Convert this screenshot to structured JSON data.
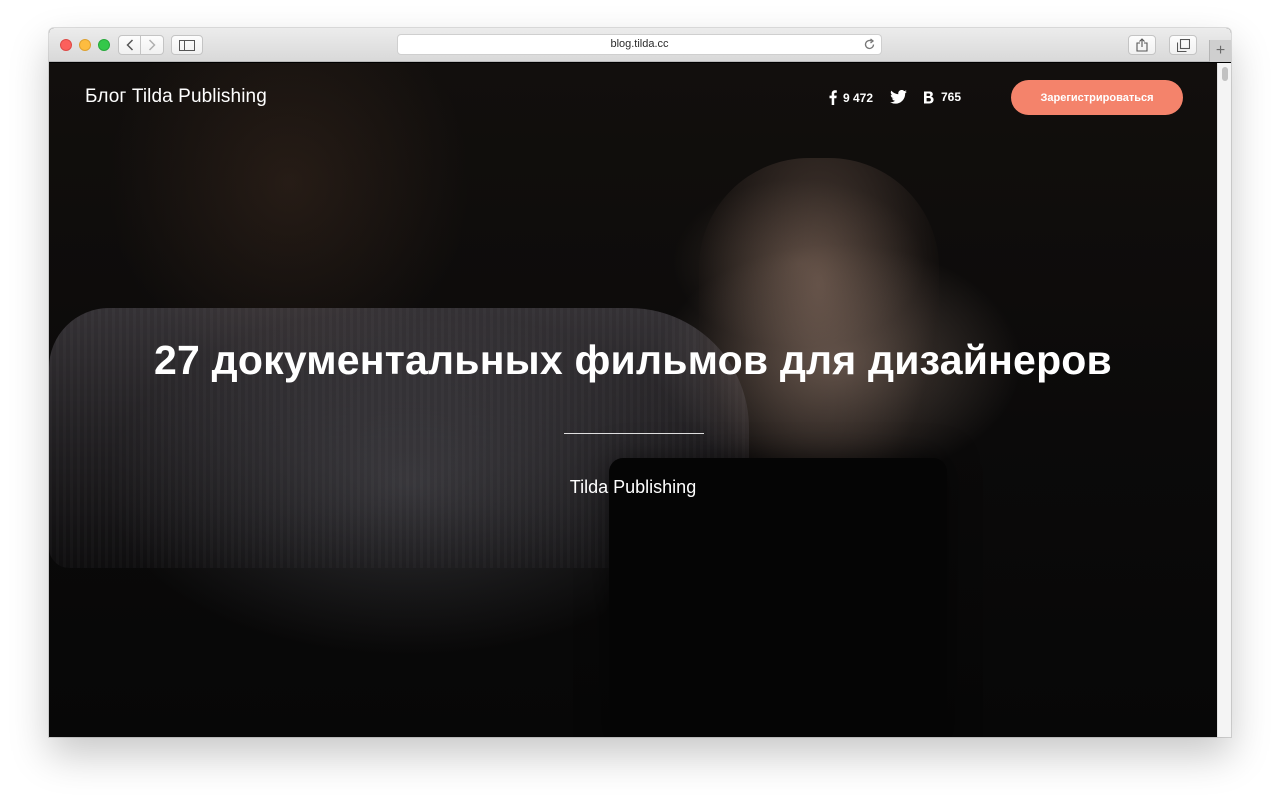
{
  "browser": {
    "url": "blog.tilda.cc",
    "icons": {
      "back": "chevron-left-icon",
      "forward": "chevron-right-icon",
      "sidebar": "sidebar-icon",
      "reload": "reload-icon",
      "share": "share-icon",
      "tabs": "tabs-icon",
      "new_tab": "+"
    }
  },
  "header": {
    "logo": "Блог Tilda Publishing",
    "social": {
      "facebook_count": "9 472",
      "vk_count": "765"
    },
    "cta_label": "Зарегистрироваться"
  },
  "hero": {
    "title": "27 документальных фильмов для дизайнеров",
    "author": "Tilda Publishing"
  },
  "colors": {
    "accent": "#f4836b",
    "hero_text": "#ffffff",
    "toolbar": "#e3e3e3"
  }
}
